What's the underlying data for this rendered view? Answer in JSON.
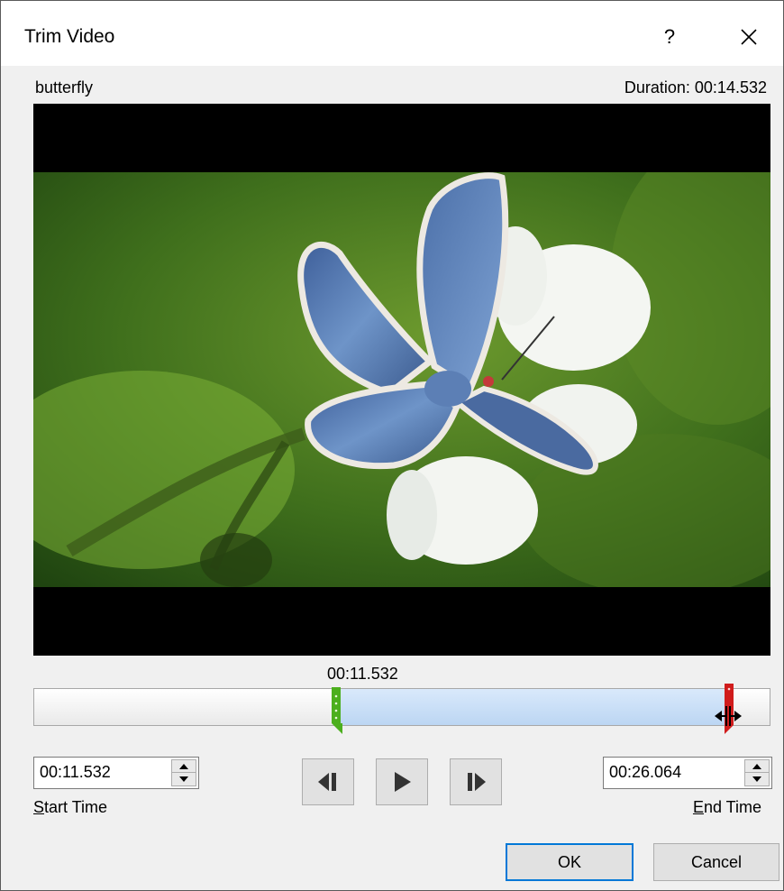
{
  "dialog": {
    "title": "Trim Video",
    "help_label": "?",
    "video_name": "butterfly",
    "duration_text": "Duration: 00:14.532"
  },
  "timeline": {
    "current_time": "00:11.532",
    "start_fraction": 0.408,
    "end_fraction": 0.944
  },
  "start_time": {
    "value": "00:11.532",
    "label_accel": "S",
    "label_rest": "tart Time"
  },
  "end_time": {
    "value": "00:26.064",
    "label_accel": "E",
    "label_rest": "nd Time"
  },
  "buttons": {
    "ok": "OK",
    "cancel": "Cancel"
  },
  "icons": [
    "help-icon",
    "close-icon",
    "previous-frame-icon",
    "play-icon",
    "next-frame-icon",
    "spin-up-icon",
    "spin-down-icon",
    "resize-cursor-icon"
  ],
  "colors": {
    "accent": "#0078d7",
    "selection": "#cfe2f8",
    "start_handle": "#4caf1e",
    "end_handle": "#d01c1c"
  }
}
